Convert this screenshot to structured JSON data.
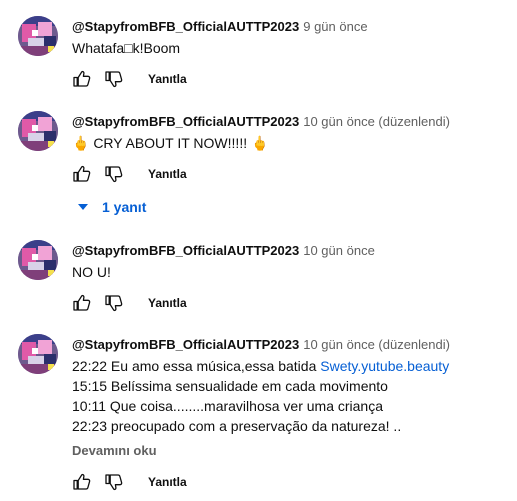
{
  "comments": [
    {
      "author": "@StapyfromBFB_OfficialAUTTP2023",
      "time": "9 gün önce",
      "lines": [
        "Whatafa□k!Boom"
      ],
      "reply_label": "Yanıtla"
    },
    {
      "author": "@StapyfromBFB_OfficialAUTTP2023",
      "time": "10 gün önce (düzenlendi)",
      "lines": [
        "🖕 CRY ABOUT IT NOW!!!!!  🖕"
      ],
      "reply_label": "Yanıtla",
      "replies_label": "1 yanıt"
    },
    {
      "author": "@StapyfromBFB_OfficialAUTTP2023",
      "time": "10 gün önce",
      "lines": [
        "NO U!"
      ],
      "reply_label": "Yanıtla"
    },
    {
      "author": "@StapyfromBFB_OfficialAUTTP2023",
      "time": "10 gün önce (düzenlendi)",
      "lines": [
        "22:22 Eu amo essa música,essa batida ",
        "15:15 Belíssima sensualidade em cada movimento",
        "10:11 Que coisa........maravilhosa ver uma criança",
        "22:23 preocupado com a preservação da natureza! .."
      ],
      "link": "Swety.yutube.beauty",
      "more_label": "Devamını oku",
      "reply_label": "Yanıtla"
    }
  ],
  "icons": {
    "like": "thumb-up-outline-icon",
    "dislike": "thumb-down-outline-icon",
    "expand": "caret-down-icon"
  },
  "colors": {
    "link": "#065fd4",
    "secondary_text": "#606060"
  }
}
